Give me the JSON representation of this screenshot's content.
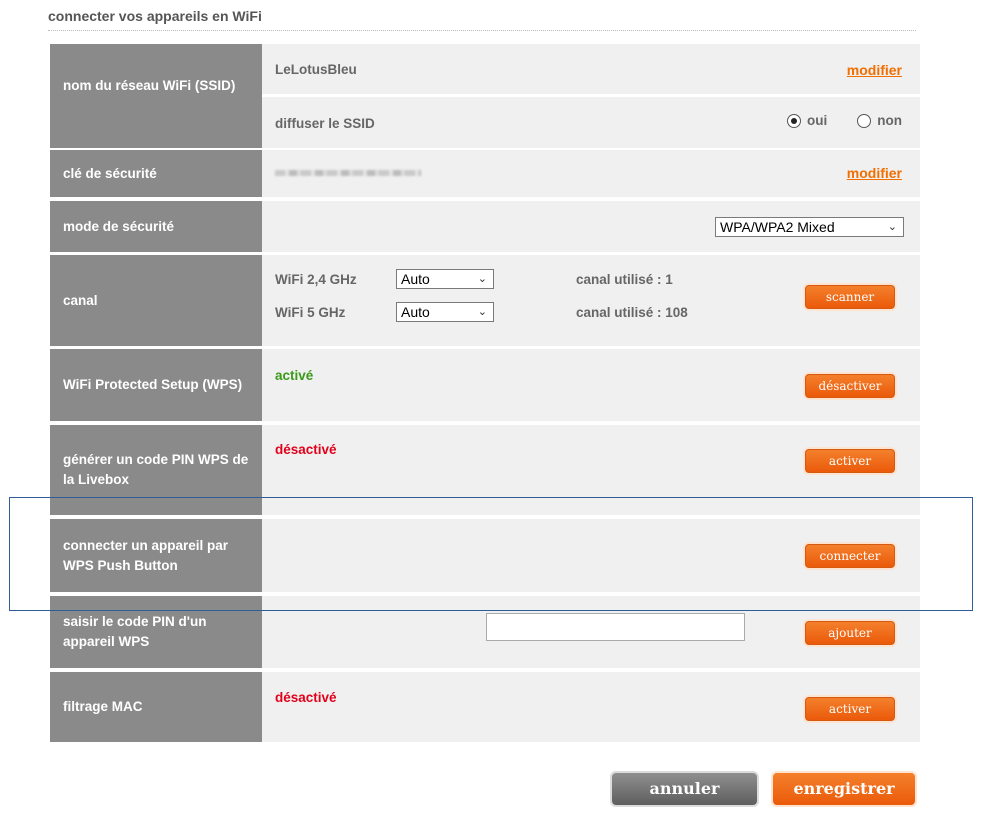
{
  "section_title": "connecter vos appareils en WiFi",
  "ssid": {
    "label": "nom du réseau WiFi (SSID)",
    "value": "LeLotusBleu",
    "modify_label": "modifier",
    "broadcast_label": "diffuser le SSID",
    "yes_label": "oui",
    "no_label": "non",
    "broadcast_selected": "oui"
  },
  "security_key": {
    "label": "clé de sécurité",
    "modify_label": "modifier"
  },
  "security_mode": {
    "label": "mode de sécurité",
    "selected": "WPA/WPA2 Mixed"
  },
  "channel": {
    "label": "canal",
    "wifi24_label": "WiFi 2,4 GHz",
    "wifi24_selected": "Auto",
    "wifi24_used": "canal utilisé : 1",
    "wifi5_label": "WiFi 5 GHz",
    "wifi5_selected": "Auto",
    "wifi5_used": "canal utilisé : 108",
    "scan_button": "scanner"
  },
  "wps": {
    "label": "WiFi Protected Setup (WPS)",
    "status": "activé",
    "status_color": "#3a9a1a",
    "button": "désactiver"
  },
  "wps_pin": {
    "label": "générer un code PIN WPS de la Livebox",
    "status": "désactivé",
    "status_color": "#e2001a",
    "button": "activer"
  },
  "wps_push": {
    "label": "connecter un appareil par WPS Push Button",
    "button": "connecter"
  },
  "device_pin": {
    "label": "saisir le code PIN d'un appareil WPS",
    "input_value": "",
    "button": "ajouter"
  },
  "mac_filter": {
    "label": "filtrage MAC",
    "status": "désactivé",
    "status_color": "#e2001a",
    "button": "activer"
  },
  "footer": {
    "cancel_label": "annuler",
    "save_label": "enregistrer"
  },
  "colors": {
    "accent": "#f16e00",
    "label_bg": "#8a8a8a",
    "content_bg": "#f0f0f0"
  }
}
